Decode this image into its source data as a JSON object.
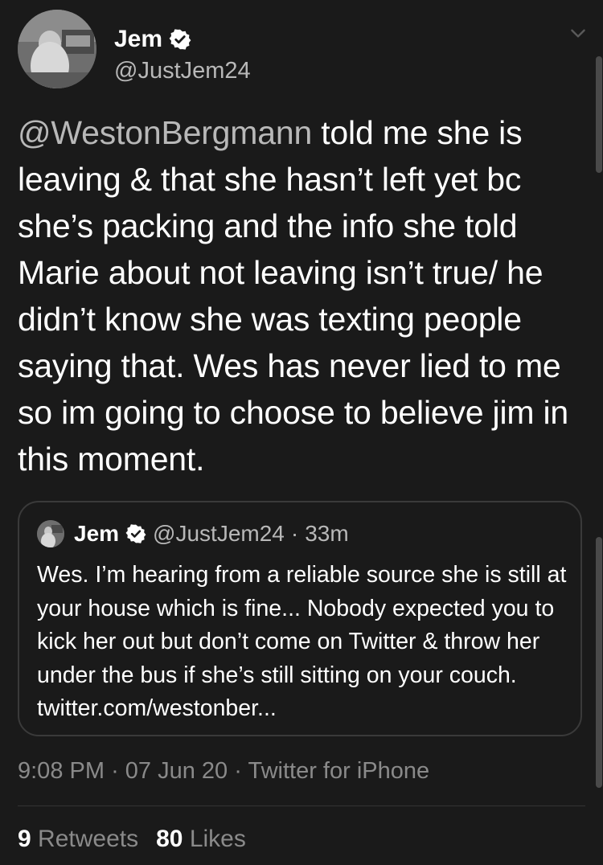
{
  "tweet": {
    "author_name": "Jem",
    "author_handle": "@JustJem24",
    "mention": "@WestonBergmann",
    "body": " told me she is leaving & that she hasn’t left yet bc she’s packing and the info she told Marie about not leaving isn’t true/ he didn’t know she was texting people saying that. Wes has never lied to me so im going to choose to believe jim in this moment.",
    "time": "9:08 PM",
    "date": "07 Jun 20",
    "client": "Twitter for iPhone",
    "separator": "·",
    "retweets_count": "9",
    "retweets_label": "Retweets",
    "likes_count": "80",
    "likes_label": "Likes"
  },
  "quoted_tweet": {
    "author_name": "Jem",
    "author_handle": "@JustJem24",
    "separator": "·",
    "age": "33m",
    "body": "Wes. I’m hearing from a reliable source she is still at your house which is fine... Nobody expected you to kick her out but don’t come on Twitter & throw her under the bus if she’s still sitting on your couch. twitter.com/westonber..."
  },
  "icons": {
    "verified": "verified-badge-icon",
    "menu": "chevron-down-icon"
  },
  "colors": {
    "background": "#1a1a1a",
    "primary_text": "#ffffff",
    "secondary_text": "#b8b8b8",
    "meta_text": "#8a8a8a",
    "border": "#3a3a3a"
  }
}
